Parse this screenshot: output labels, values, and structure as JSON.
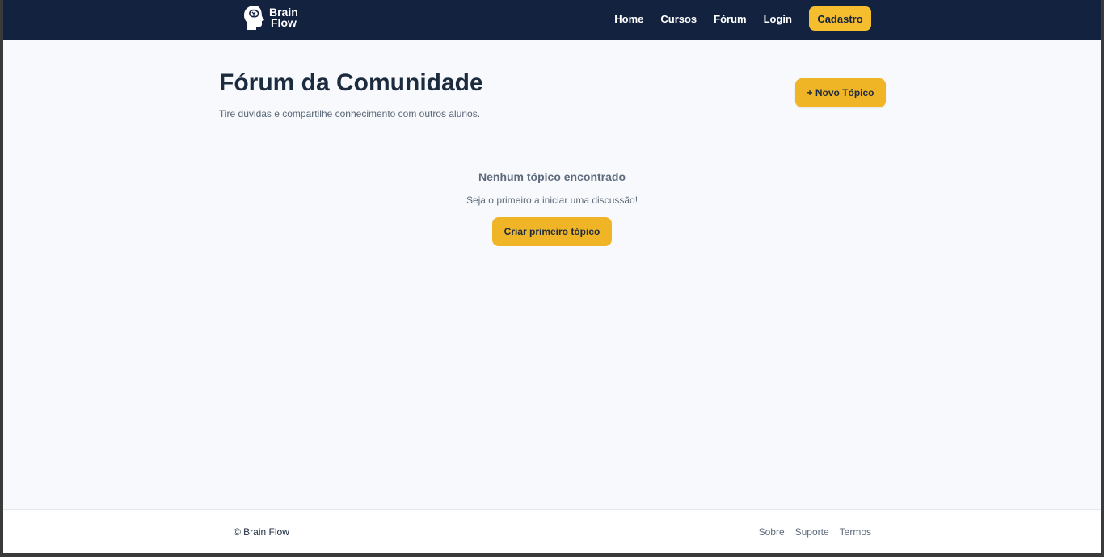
{
  "brand": {
    "line1": "Brain",
    "line2": "Flow",
    "icon": "brain-head-icon"
  },
  "nav": {
    "items": [
      {
        "label": "Home"
      },
      {
        "label": "Cursos"
      },
      {
        "label": "Fórum"
      },
      {
        "label": "Login"
      }
    ],
    "cta_label": "Cadastro"
  },
  "page": {
    "title": "Fórum da Comunidade",
    "subtitle": "Tire dúvidas e compartilhe conhecimento com outros alunos.",
    "new_topic_label": "+ Novo Tópico"
  },
  "empty_state": {
    "title": "Nenhum tópico encontrado",
    "text": "Seja o primeiro a iniciar uma discussão!",
    "button_label": "Criar primeiro tópico"
  },
  "footer": {
    "copyright": "© Brain Flow",
    "links": [
      {
        "label": "Sobre"
      },
      {
        "label": "Suporte"
      },
      {
        "label": "Termos"
      }
    ]
  },
  "colors": {
    "header_bg": "#13233f",
    "accent": "#f0b427",
    "page_bg": "#f7f9fc"
  }
}
